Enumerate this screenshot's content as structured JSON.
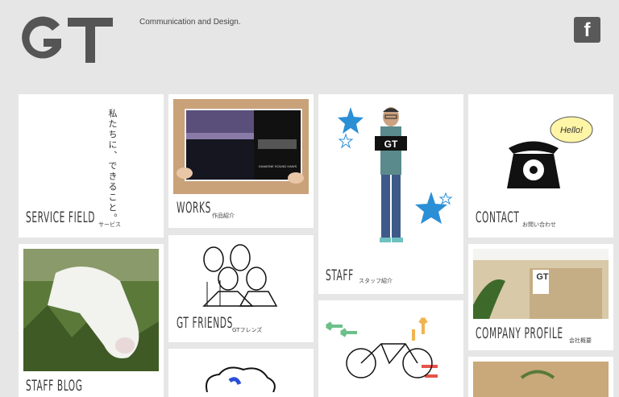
{
  "header": {
    "logo_text": "GT",
    "tagline": "Communication and Design.",
    "facebook_icon": "facebook-icon"
  },
  "tiles": {
    "service": {
      "title": "SERVICE FIELD",
      "subtitle": "サービス",
      "vertical_text": "私たちに、できること。"
    },
    "works": {
      "title": "WORKS",
      "subtitle": "作品紹介",
      "magazine_text": "DIAMONE SOUND HAWS"
    },
    "staff": {
      "title": "STAFF",
      "subtitle": "スタッフ紹介",
      "sign_text": "GT"
    },
    "contact": {
      "title": "CONTACT",
      "subtitle": "お問い合わせ",
      "bubble_text": "Hello!"
    },
    "staff_blog": {
      "title": "STAFF BLOG"
    },
    "friends": {
      "title": "GT FRIENDS",
      "subtitle": "GTフレンズ"
    },
    "company": {
      "title": "COMPANY PROFILE",
      "subtitle": "会社概要",
      "office_sign": "GT"
    }
  },
  "colors": {
    "background": "#e6e6e6",
    "logo": "#555555",
    "star": "#2b8fd6"
  }
}
